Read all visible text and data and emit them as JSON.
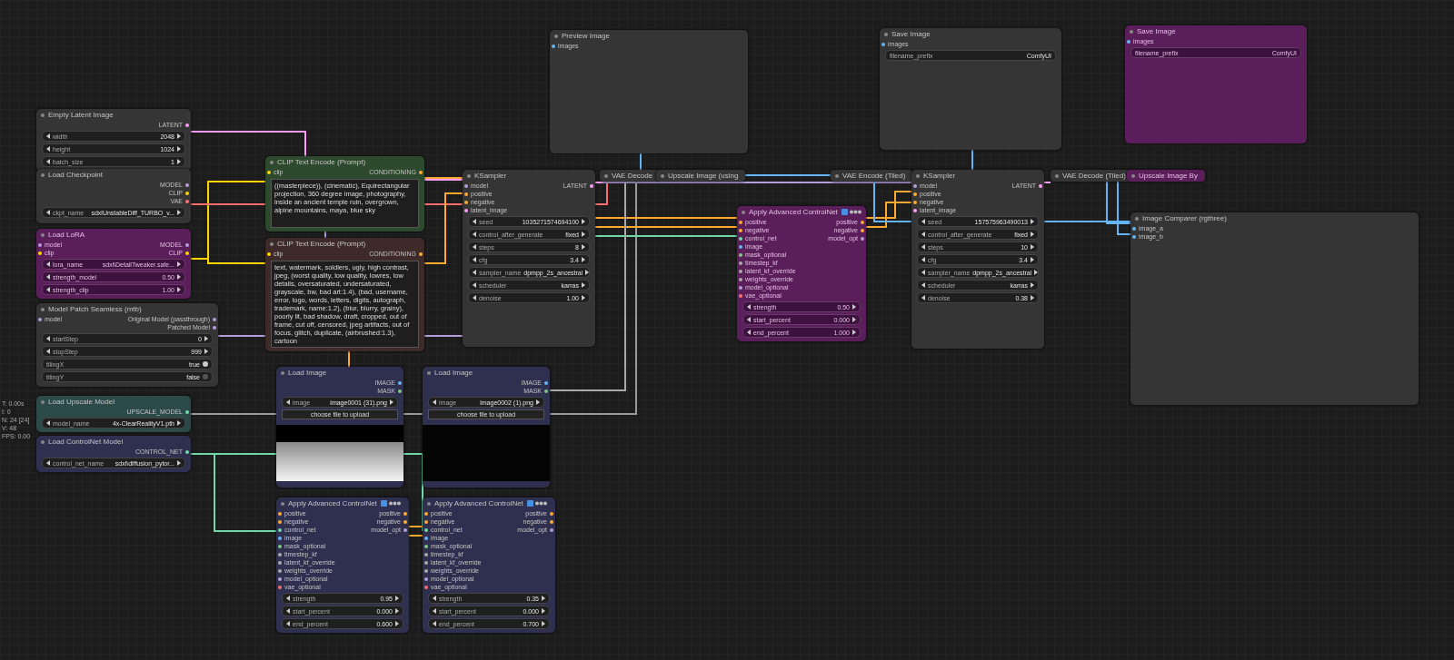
{
  "stats": [
    "T: 0.00s",
    "I: 0",
    "N: 24 [24]",
    "V: 48",
    "FPS: 0.00"
  ],
  "nodes": [
    {
      "title": "Empty Latent Image",
      "color": "#353535",
      "bypassed": false,
      "collapsed": false,
      "outputs": [
        {
          "name": "LATENT",
          "color": "#ff9cf9"
        }
      ],
      "widgets": [
        {
          "kind": "number",
          "label": "width",
          "value": "2048"
        },
        {
          "kind": "number",
          "label": "height",
          "value": "1024"
        },
        {
          "kind": "number",
          "label": "batch_size",
          "value": "1"
        }
      ]
    },
    {
      "title": "Load Checkpoint",
      "color": "#353535",
      "bypassed": false,
      "collapsed": false,
      "outputs": [
        {
          "name": "MODEL",
          "color": "#b39ddb"
        },
        {
          "name": "CLIP",
          "color": "#ffd500"
        },
        {
          "name": "VAE",
          "color": "#ff6e6e"
        }
      ],
      "widgets": [
        {
          "kind": "number",
          "label": "ckpt_name",
          "value": "sdxlUnstableDiff_TURBO_v..."
        }
      ]
    },
    {
      "title": "Load LoRA",
      "color": "#5a1f5a",
      "bypassed": true,
      "collapsed": false,
      "inputs": [
        {
          "name": "model",
          "color": "#b39ddb"
        },
        {
          "name": "clip",
          "color": "#ffd500"
        }
      ],
      "outputs": [
        {
          "name": "MODEL",
          "color": "#b39ddb"
        },
        {
          "name": "CLIP",
          "color": "#ffd500"
        }
      ],
      "widgets": [
        {
          "kind": "number",
          "label": "lora_name",
          "value": "sdxl\\DetailTweaker.safe..."
        },
        {
          "kind": "number",
          "label": "strength_model",
          "value": "0.50"
        },
        {
          "kind": "number",
          "label": "strength_clip",
          "value": "1.00"
        }
      ]
    },
    {
      "title": "Model Patch Seamless (mtb)",
      "color": "#353535",
      "bypassed": false,
      "collapsed": false,
      "inputs": [
        {
          "name": "model",
          "color": "#b39ddb"
        }
      ],
      "outputs": [
        {
          "name": "Original Model (passthrough)",
          "color": "#b39ddb"
        },
        {
          "name": "Patched Model",
          "color": "#b39ddb"
        }
      ],
      "widgets": [
        {
          "kind": "number",
          "label": "startStep",
          "value": "0"
        },
        {
          "kind": "number",
          "label": "stopStep",
          "value": "999"
        },
        {
          "kind": "toggle",
          "label": "tilingX",
          "value": "true",
          "on": true
        },
        {
          "kind": "toggle",
          "label": "tilingY",
          "value": "false",
          "on": false
        }
      ]
    },
    {
      "title": "Load Upscale Model",
      "color": "#2c4a4a",
      "bypassed": false,
      "collapsed": false,
      "outputs": [
        {
          "name": "UPSCALE_MODEL",
          "color": "#6fd8a8"
        }
      ],
      "widgets": [
        {
          "kind": "number",
          "label": "model_name",
          "value": "4x-ClearRealityV1.pth"
        }
      ]
    },
    {
      "title": "Load ControlNet Model",
      "color": "#2f2f4f",
      "bypassed": false,
      "collapsed": false,
      "outputs": [
        {
          "name": "CONTROL_NET",
          "color": "#6fd8a8"
        }
      ],
      "widgets": [
        {
          "kind": "number",
          "label": "control_net_name",
          "value": "sdxl\\diffusion_pytor..."
        }
      ]
    },
    {
      "title": "CLIP Text Encode (Prompt)",
      "color": "#2e4a2e",
      "bypassed": false,
      "collapsed": false,
      "inputs": [
        {
          "name": "clip",
          "color": "#ffd500"
        }
      ],
      "outputs": [
        {
          "name": "CONDITIONING",
          "color": "#ffa931"
        }
      ],
      "widgets": [
        {
          "kind": "text",
          "value": "((masterpiece)), (cinematic), Equirectangular projection, 360 degree image, photography, inside an ancient temple ruin, overgrown, alpine mountains, maya, blue sky"
        }
      ]
    },
    {
      "title": "CLIP Text Encode (Prompt)",
      "color": "#3f2a2a",
      "bypassed": false,
      "collapsed": false,
      "inputs": [
        {
          "name": "clip",
          "color": "#ffd500"
        }
      ],
      "outputs": [
        {
          "name": "CONDITIONING",
          "color": "#ffa931"
        }
      ],
      "widgets": [
        {
          "kind": "text",
          "value": "text, watermark, soldiers, ugly, high contrast, jpeg, (worst quality, low quality, lowres, low details, oversaturated, undersaturated, grayscale, bw, bad art:1.4), (bad, username, error, logo, words, letters, digits, autograph, trademark, name:1.2), (blur, blurry, grainy), poorly lit, bad shadow, draft, cropped, out of frame, cut off, censored, jpeg artifacts, out of focus, glitch, duplicate, (airbrushed:1.3), cartoon"
        }
      ]
    },
    {
      "title": "KSampler",
      "color": "#353535",
      "bypassed": false,
      "collapsed": false,
      "inputs": [
        {
          "name": "model",
          "color": "#b39ddb"
        },
        {
          "name": "positive",
          "color": "#ffa931"
        },
        {
          "name": "negative",
          "color": "#ffa931"
        },
        {
          "name": "latent_image",
          "color": "#ff9cf9"
        }
      ],
      "outputs": [
        {
          "name": "LATENT",
          "color": "#ff9cf9"
        }
      ],
      "widgets": [
        {
          "kind": "number",
          "label": "seed",
          "value": "1035271574694100"
        },
        {
          "kind": "number",
          "label": "control_after_generate",
          "value": "fixed"
        },
        {
          "kind": "number",
          "label": "steps",
          "value": "8"
        },
        {
          "kind": "number",
          "label": "cfg",
          "value": "3.4"
        },
        {
          "kind": "number",
          "label": "sampler_name",
          "value": "dpmpp_2s_ancestral"
        },
        {
          "kind": "number",
          "label": "scheduler",
          "value": "karras"
        },
        {
          "kind": "number",
          "label": "denoise",
          "value": "1.00"
        }
      ]
    },
    {
      "title": "VAE Decode",
      "color": "#353535",
      "bypassed": false,
      "collapsed": true
    },
    {
      "title": "Upscale Image (using",
      "color": "#353535",
      "bypassed": false,
      "collapsed": true
    },
    {
      "title": "VAE Encode (Tiled)",
      "color": "#353535",
      "bypassed": false,
      "collapsed": true
    },
    {
      "title": "KSampler",
      "color": "#353535",
      "bypassed": false,
      "collapsed": false,
      "inputs": [
        {
          "name": "model",
          "color": "#b39ddb"
        },
        {
          "name": "positive",
          "color": "#ffa931"
        },
        {
          "name": "negative",
          "color": "#ffa931"
        },
        {
          "name": "latent_image",
          "color": "#ff9cf9"
        }
      ],
      "outputs": [
        {
          "name": "LATENT",
          "color": "#ff9cf9"
        }
      ],
      "widgets": [
        {
          "kind": "number",
          "label": "seed",
          "value": "157575963490013"
        },
        {
          "kind": "number",
          "label": "control_after_generate",
          "value": "fixed"
        },
        {
          "kind": "number",
          "label": "steps",
          "value": "10"
        },
        {
          "kind": "number",
          "label": "cfg",
          "value": "3.4"
        },
        {
          "kind": "number",
          "label": "sampler_name",
          "value": "dpmpp_2s_ancestral"
        },
        {
          "kind": "number",
          "label": "scheduler",
          "value": "karras"
        },
        {
          "kind": "number",
          "label": "denoise",
          "value": "0.38"
        }
      ]
    },
    {
      "title": "VAE Decode (Tiled)",
      "color": "#353535",
      "bypassed": false,
      "collapsed": true
    },
    {
      "title": "Upscale Image By",
      "color": "#5a1f5a",
      "bypassed": true,
      "collapsed": true
    },
    {
      "title": "Preview Image",
      "color": "#353535",
      "bypassed": false,
      "collapsed": false,
      "inputs": [
        {
          "name": "images",
          "color": "#64b5f6"
        }
      ]
    },
    {
      "title": "Save Image",
      "color": "#353535",
      "bypassed": false,
      "collapsed": false,
      "inputs": [
        {
          "name": "images",
          "color": "#64b5f6"
        }
      ],
      "widgets": [
        {
          "kind": "field",
          "label": "filename_prefix",
          "value": "ComfyUI"
        }
      ]
    },
    {
      "title": "Save Image",
      "color": "#5a1f5a",
      "bypassed": true,
      "collapsed": false,
      "inputs": [
        {
          "name": "images",
          "color": "#64b5f6"
        }
      ],
      "widgets": [
        {
          "kind": "field",
          "label": "filename_prefix",
          "value": "ComfyUI"
        }
      ]
    },
    {
      "title": "Image Comparer (rgthree)",
      "color": "#353535",
      "bypassed": false,
      "collapsed": false,
      "inputs": [
        {
          "name": "image_a",
          "color": "#64b5f6"
        },
        {
          "name": "image_b",
          "color": "#64b5f6"
        }
      ]
    },
    {
      "title": "Apply Advanced ControlNet",
      "color": "#5a1f5a",
      "bypassed": true,
      "collapsed": false,
      "badges": true,
      "inputs": [
        {
          "name": "positive",
          "color": "#ffa931"
        },
        {
          "name": "negative",
          "color": "#ffa931"
        },
        {
          "name": "control_net",
          "color": "#6fd8a8"
        },
        {
          "name": "image",
          "color": "#64b5f6"
        },
        {
          "name": "mask_optional",
          "color": "#81c784"
        },
        {
          "name": "timestep_kf",
          "color": "#aaaaaa"
        },
        {
          "name": "latent_kf_override",
          "color": "#aaaaaa"
        },
        {
          "name": "weights_override",
          "color": "#aaaaaa"
        },
        {
          "name": "model_optional",
          "color": "#b39ddb"
        },
        {
          "name": "vae_optional",
          "color": "#ff6e6e"
        }
      ],
      "outputs": [
        {
          "name": "positive",
          "color": "#ffa931"
        },
        {
          "name": "negative",
          "color": "#ffa931"
        },
        {
          "name": "model_opt",
          "color": "#b39ddb"
        }
      ],
      "widgets": [
        {
          "kind": "number",
          "label": "strength",
          "value": "0.50"
        },
        {
          "kind": "number",
          "label": "start_percent",
          "value": "0.000"
        },
        {
          "kind": "number",
          "label": "end_percent",
          "value": "1.000"
        }
      ]
    },
    {
      "title": "Load Image",
      "color": "#2f2f4f",
      "bypassed": false,
      "collapsed": false,
      "preview": {
        "kind": "light"
      },
      "outputs": [
        {
          "name": "IMAGE",
          "color": "#64b5f6"
        },
        {
          "name": "MASK",
          "color": "#81c784"
        }
      ],
      "widgets": [
        {
          "kind": "number",
          "label": "image",
          "value": "image0001 (31).png"
        },
        {
          "kind": "button",
          "label": "choose file to upload"
        }
      ]
    },
    {
      "title": "Load Image",
      "color": "#2f2f4f",
      "bypassed": false,
      "collapsed": false,
      "preview": {
        "kind": "dark"
      },
      "outputs": [
        {
          "name": "IMAGE",
          "color": "#64b5f6"
        },
        {
          "name": "MASK",
          "color": "#81c784"
        }
      ],
      "widgets": [
        {
          "kind": "number",
          "label": "image",
          "value": "image0002 (1).png"
        },
        {
          "kind": "button",
          "label": "choose file to upload"
        }
      ]
    },
    {
      "title": "Apply Advanced ControlNet",
      "color": "#2f2f4f",
      "bypassed": false,
      "collapsed": false,
      "badges": true,
      "inputs": [
        {
          "name": "positive",
          "color": "#ffa931"
        },
        {
          "name": "negative",
          "color": "#ffa931"
        },
        {
          "name": "control_net",
          "color": "#6fd8a8"
        },
        {
          "name": "image",
          "color": "#64b5f6"
        },
        {
          "name": "mask_optional",
          "color": "#81c784"
        },
        {
          "name": "timestep_kf",
          "color": "#aaaaaa"
        },
        {
          "name": "latent_kf_override",
          "color": "#aaaaaa"
        },
        {
          "name": "weights_override",
          "color": "#aaaaaa"
        },
        {
          "name": "model_optional",
          "color": "#b39ddb"
        },
        {
          "name": "vae_optional",
          "color": "#ff6e6e"
        }
      ],
      "outputs": [
        {
          "name": "positive",
          "color": "#ffa931"
        },
        {
          "name": "negative",
          "color": "#ffa931"
        },
        {
          "name": "model_opt",
          "color": "#b39ddb"
        }
      ],
      "widgets": [
        {
          "kind": "number",
          "label": "strength",
          "value": "0.95"
        },
        {
          "kind": "number",
          "label": "start_percent",
          "value": "0.000"
        },
        {
          "kind": "number",
          "label": "end_percent",
          "value": "0.600"
        }
      ]
    },
    {
      "title": "Apply Advanced ControlNet",
      "color": "#2f2f4f",
      "bypassed": false,
      "collapsed": false,
      "badges": true,
      "inputs": [
        {
          "name": "positive",
          "color": "#ffa931"
        },
        {
          "name": "negative",
          "color": "#ffa931"
        },
        {
          "name": "control_net",
          "color": "#6fd8a8"
        },
        {
          "name": "image",
          "color": "#64b5f6"
        },
        {
          "name": "mask_optional",
          "color": "#81c784"
        },
        {
          "name": "timestep_kf",
          "color": "#aaaaaa"
        },
        {
          "name": "latent_kf_override",
          "color": "#aaaaaa"
        },
        {
          "name": "weights_override",
          "color": "#aaaaaa"
        },
        {
          "name": "model_optional",
          "color": "#b39ddb"
        },
        {
          "name": "vae_optional",
          "color": "#ff6e6e"
        }
      ],
      "outputs": [
        {
          "name": "positive",
          "color": "#ffa931"
        },
        {
          "name": "negative",
          "color": "#ffa931"
        },
        {
          "name": "model_opt",
          "color": "#b39ddb"
        }
      ],
      "widgets": [
        {
          "kind": "number",
          "label": "strength",
          "value": "0.35"
        },
        {
          "kind": "number",
          "label": "start_percent",
          "value": "0.000"
        },
        {
          "kind": "number",
          "label": "end_percent",
          "value": "0.700"
        }
      ]
    }
  ]
}
